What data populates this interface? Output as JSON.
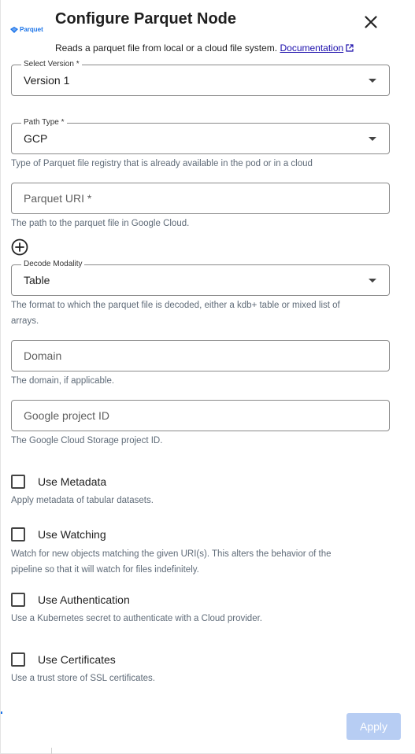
{
  "header": {
    "logo_text": "Parquet",
    "title": "Configure Parquet Node",
    "subtitle": "Reads a parquet file from local or a cloud file system.",
    "documentation_link": "Documentation"
  },
  "fields": {
    "version": {
      "label": "Select Version *",
      "value": "Version 1"
    },
    "path_type": {
      "label": "Path Type *",
      "value": "GCP",
      "helper": "Type of Parquet file registry that is already available in the pod or in a cloud"
    },
    "parquet_uri": {
      "placeholder": "Parquet URI *",
      "value": "",
      "helper": "The path to the parquet file in Google Cloud."
    },
    "decode_modality": {
      "label": "Decode Modality",
      "value": "Table",
      "helper_line1": "The format to which the parquet file is decoded, either a kdb+ table or mixed list of",
      "helper_line2": "arrays."
    },
    "domain": {
      "placeholder": "Domain",
      "value": "",
      "helper": "The domain, if applicable."
    },
    "project_id": {
      "placeholder": "Google project ID",
      "value": "",
      "helper": "The Google Cloud Storage project ID."
    }
  },
  "options": {
    "metadata": {
      "label": "Use Metadata",
      "checked": false,
      "helper": "Apply metadata of tabular datasets."
    },
    "watching": {
      "label": "Use Watching",
      "checked": false,
      "helper_line1": "Watch for new objects matching the given URI(s). This alters the behavior of the",
      "helper_line2": "pipeline so that it will watch for files indefinitely."
    },
    "authentication": {
      "label": "Use Authentication",
      "checked": false,
      "helper": "Use a Kubernetes secret to authenticate with a Cloud provider."
    },
    "certificates": {
      "label": "Use Certificates",
      "checked": false,
      "helper": "Use a trust store of SSL certificates."
    }
  },
  "footer": {
    "apply_label": "Apply",
    "apply_disabled": true
  },
  "colors": {
    "accent": "#1a73e8",
    "apply_disabled_bg": "#b7cdf3",
    "helper_text": "#5f6b78"
  },
  "icons": {
    "close": "close-icon",
    "add": "add-circle-icon",
    "dropdown": "chevron-down-icon",
    "external_link": "external-link-icon",
    "logo": "parquet-logo-icon"
  }
}
